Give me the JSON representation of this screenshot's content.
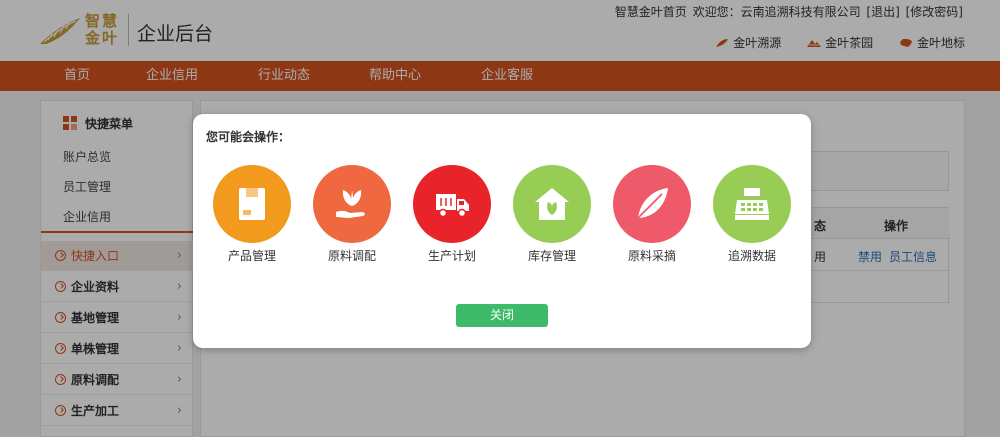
{
  "header": {
    "logo_text_line1": "智慧",
    "logo_text_line2": "金叶",
    "title": "企业后台",
    "top_links": {
      "home": "智慧金叶首页",
      "welcome": "欢迎您：云南追溯科技有限公司",
      "logout": "[退出]",
      "change_password": "[修改密码]"
    },
    "sites": [
      {
        "label": "金叶溯源",
        "icon": "leaf-icon"
      },
      {
        "label": "金叶茶园",
        "icon": "tea-garden-icon"
      },
      {
        "label": "金叶地标",
        "icon": "china-map-icon"
      }
    ]
  },
  "nav": {
    "items": [
      "首页",
      "企业信用",
      "行业动态",
      "帮助中心",
      "企业客服"
    ]
  },
  "sidebar": {
    "quick_menu_title": "快捷菜单",
    "quick_links": [
      "账户总览",
      "员工管理",
      "企业信用"
    ],
    "items": [
      {
        "label": "快捷入口",
        "active": true
      },
      {
        "label": "企业资料"
      },
      {
        "label": "基地管理"
      },
      {
        "label": "单株管理"
      },
      {
        "label": "原料调配"
      },
      {
        "label": "生产加工"
      }
    ]
  },
  "table": {
    "headers": [
      "态",
      "操作"
    ],
    "row": {
      "status": "用",
      "action1": "禁用",
      "action2": "员工信息"
    }
  },
  "modal": {
    "title": "您可能会操作：",
    "operations": [
      {
        "label": "产品管理",
        "icon": "box-icon",
        "color": "#f29a1e"
      },
      {
        "label": "原料调配",
        "icon": "plant-hand-icon",
        "color": "#ef6840"
      },
      {
        "label": "生产计划",
        "icon": "truck-icon",
        "color": "#e8232a"
      },
      {
        "label": "库存管理",
        "icon": "warehouse-icon",
        "color": "#97cd55"
      },
      {
        "label": "原料采摘",
        "icon": "leaf-icon",
        "color": "#ef5a6b"
      },
      {
        "label": "追溯数据",
        "icon": "cash-register-icon",
        "color": "#97cd55"
      }
    ],
    "close_label": "关闭"
  },
  "colors": {
    "brand": "#d4531f",
    "close_button": "#3dbb6a"
  }
}
